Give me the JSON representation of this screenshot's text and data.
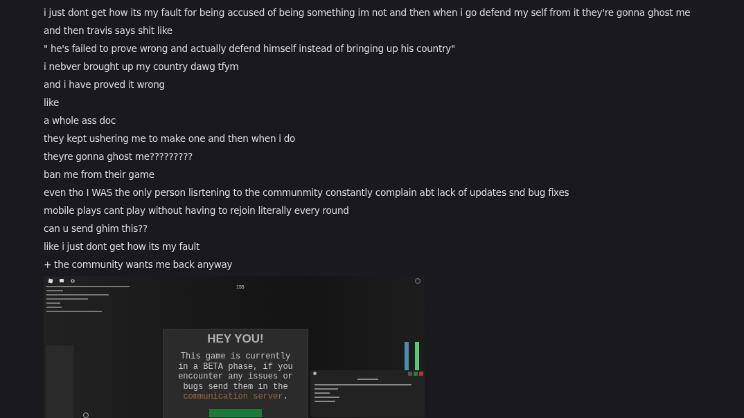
{
  "messages": [
    {
      "text": "i just dont get how its my fault for being accused of being something im not and then when i go defend my self from it they're gonna ghost me"
    },
    {
      "text": "and then travis says shit like"
    },
    {
      "text": "\" he's failed to prove wrong and actually defend himself instead of bringing up his country\""
    },
    {
      "text": "i nebver brought up my country dawg tfym"
    },
    {
      "text": "and i have proved it wrong"
    },
    {
      "text": "like"
    },
    {
      "text": "a whole ass doc"
    },
    {
      "text": "they kept ushering me to make one and then when i do"
    },
    {
      "text": "theyre gonna ghost me?????????"
    },
    {
      "text": "ban me from their game"
    },
    {
      "text": "even tho I WAS the only person lisrtening to the communmity constantly complain abt lack of updates snd bug fixes"
    },
    {
      "text": "mobile plays cant play without having to rejoin literally every round"
    },
    {
      "text": "can u send ghim this??"
    },
    {
      "text": "like i just dont get how its my fault"
    },
    {
      "text": "+ the community wants me back anyway"
    }
  ],
  "attachment": {
    "counter": "155",
    "notice": {
      "title": "HEY YOU!",
      "body": "This game is currently in a BETA phase, if you encounter any issues or bugs send them in the ",
      "link": "communication server",
      "end": "."
    }
  }
}
